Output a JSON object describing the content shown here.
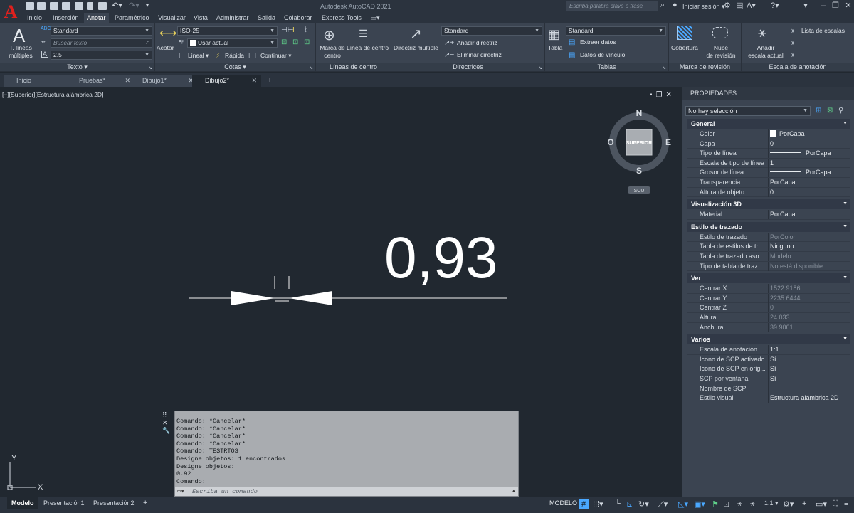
{
  "app": {
    "title": "Autodesk AutoCAD 2021",
    "logo": "A"
  },
  "search": {
    "placeholder": "Escriba palabra clave o frase"
  },
  "user": {
    "signin": "Iniciar sesión"
  },
  "menu_tabs": [
    "Inicio",
    "Inserción",
    "Anotar",
    "Paramétrico",
    "Visualizar",
    "Vista",
    "Administrar",
    "Salida",
    "Colaborar",
    "Express Tools"
  ],
  "active_menu_tab": "Anotar",
  "ribbon": {
    "texto": {
      "title": "Texto",
      "big_button": "T. líneas\nmúltiples",
      "style": "Standard",
      "find_placeholder": "Buscar texto",
      "height": "2.5"
    },
    "cotas": {
      "title": "Cotas",
      "big_button": "Acotar",
      "style": "ISO-25",
      "layer": "Usar actual",
      "linear": "Lineal",
      "quick": "Rápida",
      "continue": "Continuar"
    },
    "lineas_centro": {
      "title": "Líneas de centro",
      "btn_marca": "Marca de\ncentro",
      "btn_linea": "Línea de centro"
    },
    "directrices": {
      "title": "Directrices",
      "big_button": "Directriz múltiple",
      "style": "Standard",
      "add": "Añadir directriz",
      "remove": "Eliminar directriz"
    },
    "tablas": {
      "title": "Tablas",
      "big_button": "Tabla",
      "style": "Standard",
      "extract": "Extraer datos",
      "link": "Datos de vínculo"
    },
    "marca_revision": {
      "title": "Marca de revisión",
      "btn_cobertura": "Cobertura",
      "btn_nube": "Nube\nde revisión"
    },
    "escala": {
      "title": "Escala de anotación",
      "big_button": "Añadir\nescala actual",
      "list": "Lista de escalas"
    }
  },
  "file_tabs": [
    "Inicio",
    "Pruebas*",
    "Dibujo1*",
    "Dibujo2*"
  ],
  "active_file_tab": "Dibujo2*",
  "viewport": {
    "label": "[−][Superior][Estructura alámbrica 2D]",
    "dimension_text": "0,93",
    "viewcube": {
      "face": "SUPERIOR",
      "n": "N",
      "s": "S",
      "e": "E",
      "w": "O",
      "ucs": "SCU"
    },
    "ucs_axes": {
      "x": "X",
      "y": "Y"
    }
  },
  "properties": {
    "title": "PROPIEDADES",
    "selection": "No hay selección",
    "sections": [
      {
        "name": "General",
        "rows": [
          {
            "k": "Color",
            "v": "PorCapa",
            "dim": false,
            "swatch": true
          },
          {
            "k": "Capa",
            "v": "0",
            "dim": false
          },
          {
            "k": "Tipo de línea",
            "v": "PorCapa",
            "dim": false,
            "line": true
          },
          {
            "k": "Escala de tipo de línea",
            "v": "1",
            "dim": false
          },
          {
            "k": "Grosor de línea",
            "v": "PorCapa",
            "dim": false,
            "line": true
          },
          {
            "k": "Transparencia",
            "v": "PorCapa",
            "dim": false
          },
          {
            "k": "Altura de objeto",
            "v": "0",
            "dim": false
          }
        ]
      },
      {
        "name": "Visualización 3D",
        "rows": [
          {
            "k": "Material",
            "v": "PorCapa",
            "dim": false
          }
        ]
      },
      {
        "name": "Estilo de trazado",
        "rows": [
          {
            "k": "Estilo de trazado",
            "v": "PorColor",
            "dim": true
          },
          {
            "k": "Tabla de estilos de tr...",
            "v": "Ninguno",
            "dim": false
          },
          {
            "k": "Tabla de trazado aso...",
            "v": "Modelo",
            "dim": true
          },
          {
            "k": "Tipo de tabla de traz...",
            "v": "No está disponible",
            "dim": true
          }
        ]
      },
      {
        "name": "Ver",
        "rows": [
          {
            "k": "Centrar X",
            "v": "1522.9186",
            "dim": true
          },
          {
            "k": "Centrar Y",
            "v": "2235.6444",
            "dim": true
          },
          {
            "k": "Centrar Z",
            "v": "0",
            "dim": true
          },
          {
            "k": "Altura",
            "v": "24.033",
            "dim": true
          },
          {
            "k": "Anchura",
            "v": "39.9061",
            "dim": true
          }
        ]
      },
      {
        "name": "Varios",
        "rows": [
          {
            "k": "Escala de anotación",
            "v": "1:1",
            "dim": false
          },
          {
            "k": "Icono de SCP activado",
            "v": "Sí",
            "dim": false
          },
          {
            "k": "Icono de SCP en orig...",
            "v": "Sí",
            "dim": false
          },
          {
            "k": "SCP por ventana",
            "v": "Sí",
            "dim": false
          },
          {
            "k": "Nombre de SCP",
            "v": "",
            "dim": false
          },
          {
            "k": "Estilo visual",
            "v": "Estructura alámbrica 2D",
            "dim": false
          }
        ]
      }
    ]
  },
  "command": {
    "history": [
      "Comando: *Cancelar*",
      "Comando: *Cancelar*",
      "Comando: *Cancelar*",
      "Comando: *Cancelar*",
      "Comando: TESTRTOS",
      "Designe objetos: 1 encontrados",
      "Designe objetos:",
      "0.92",
      "Comando:"
    ],
    "placeholder": "Escriba un comando"
  },
  "status": {
    "layout_tabs": [
      "Modelo",
      "Presentación1",
      "Presentación2"
    ],
    "active_layout": "Modelo",
    "mode": "MODELO",
    "scale": "1:1"
  }
}
